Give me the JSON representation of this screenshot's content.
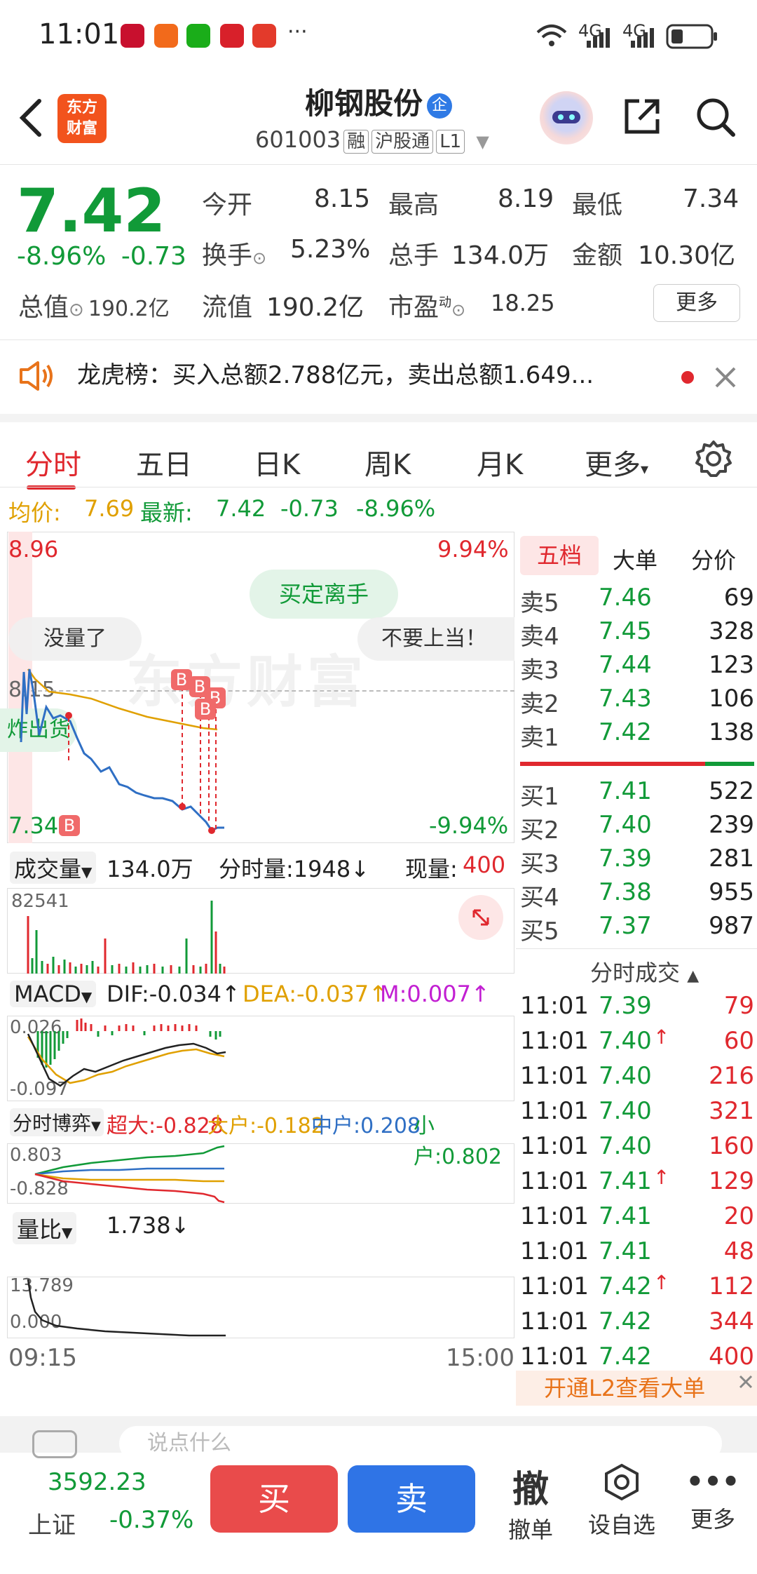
{
  "status": {
    "time": "11:01",
    "more_dots": "···",
    "net1": "4G",
    "net2": "4G"
  },
  "header": {
    "logo_line1": "东方",
    "logo_line2": "财富",
    "stock_name": "柳钢股份",
    "ent_badge": "企",
    "stock_code": "601003",
    "tag_rong": "融",
    "tag_hgt": "沪股通",
    "tag_level": "L1"
  },
  "quote": {
    "price": "7.42",
    "change_pct": "-8.96%",
    "change_abs": "-0.73",
    "open_label": "今开",
    "open": "8.15",
    "high_label": "最高",
    "high": "8.19",
    "low_label": "最低",
    "low": "7.34",
    "turnover_label": "换手",
    "turnover": "5.23%",
    "volume_label": "总手",
    "volume": "134.0万",
    "amount_label": "金额",
    "amount": "10.30亿",
    "mktcap_label": "总值",
    "mktcap": "190.2亿",
    "float_label": "流值",
    "float_cap": "190.2亿",
    "pe_label": "市盈",
    "pe_sup": "动",
    "pe": "18.25",
    "more_label": "更多"
  },
  "news": {
    "text": "龙虎榜：买入总额2.788亿元，卖出总额1.649..."
  },
  "tabs": [
    "分时",
    "五日",
    "日K",
    "周K",
    "月K",
    "更多"
  ],
  "avg_line": {
    "avg_label": "均价:",
    "avg": "7.69",
    "latest_label": "最新:",
    "latest": "7.42",
    "change": "-0.73",
    "change_pct": "-8.96%"
  },
  "chart": {
    "price_high": "8.96",
    "pct_high": "9.94%",
    "price_low": "7.34",
    "pct_low": "-9.94%",
    "ref_price": "8.15",
    "bullet_1": "买定离手",
    "bullet_2": "没量了",
    "bullet_3": "不要上当！",
    "bullet_4": "炸出货",
    "watermark": "东方财富",
    "vol_selector": "成交量",
    "vol_total": "134.0万",
    "vol_tick_label": "分时量:1948↓",
    "vol_now_label": "现量:",
    "vol_now": "400",
    "vol_max": "82541",
    "macd_selector": "MACD",
    "macd_dif": "DIF:-0.034↑",
    "macd_dea": "DEA:-0.037↑",
    "macd_m": "M:0.007↑",
    "macd_top": "0.026",
    "macd_bottom": "-0.097",
    "flow_selector": "分时博弈",
    "flow_super": "超大:-0.828",
    "flow_big": "大户:-0.182",
    "flow_mid": "中户:0.208",
    "flow_small": "小户:0.802",
    "flow_top": "0.803",
    "flow_bottom": "-0.828",
    "ratio_selector": "量比",
    "ratio_value": "1.738↓",
    "ratio_top": "13.789",
    "ratio_bottom": "0.000",
    "time_start": "09:15",
    "time_end": "15:00",
    "marker": "B"
  },
  "book": {
    "tab_five": "五档",
    "tab_big": "大单",
    "tab_price": "分价",
    "asks": [
      {
        "label": "卖5",
        "price": "7.46",
        "vol": "69"
      },
      {
        "label": "卖4",
        "price": "7.45",
        "vol": "328"
      },
      {
        "label": "卖3",
        "price": "7.44",
        "vol": "123"
      },
      {
        "label": "卖2",
        "price": "7.43",
        "vol": "106"
      },
      {
        "label": "卖1",
        "price": "7.42",
        "vol": "138"
      }
    ],
    "bids": [
      {
        "label": "买1",
        "price": "7.41",
        "vol": "522"
      },
      {
        "label": "买2",
        "price": "7.40",
        "vol": "239"
      },
      {
        "label": "买3",
        "price": "7.39",
        "vol": "281"
      },
      {
        "label": "买4",
        "price": "7.38",
        "vol": "955"
      },
      {
        "label": "买5",
        "price": "7.37",
        "vol": "987"
      }
    ],
    "ticks_title": "分时成交",
    "ticks": [
      {
        "time": "11:01",
        "price": "7.39",
        "vol": "79",
        "arrow": ""
      },
      {
        "time": "11:01",
        "price": "7.40",
        "vol": "60",
        "arrow": "↑"
      },
      {
        "time": "11:01",
        "price": "7.40",
        "vol": "216",
        "arrow": ""
      },
      {
        "time": "11:01",
        "price": "7.40",
        "vol": "321",
        "arrow": ""
      },
      {
        "time": "11:01",
        "price": "7.40",
        "vol": "160",
        "arrow": ""
      },
      {
        "time": "11:01",
        "price": "7.41",
        "vol": "129",
        "arrow": "↑"
      },
      {
        "time": "11:01",
        "price": "7.41",
        "vol": "20",
        "arrow": ""
      },
      {
        "time": "11:01",
        "price": "7.41",
        "vol": "48",
        "arrow": ""
      },
      {
        "time": "11:01",
        "price": "7.42",
        "vol": "112",
        "arrow": "↑"
      },
      {
        "time": "11:01",
        "price": "7.42",
        "vol": "344",
        "arrow": ""
      },
      {
        "time": "11:01",
        "price": "7.42",
        "vol": "400",
        "arrow": ""
      }
    ],
    "l2_promo": "开通L2查看大单"
  },
  "bottom": {
    "index_value": "3592.23",
    "index_name": "上证",
    "index_change": "-0.37%",
    "buy": "买",
    "sell": "卖",
    "cancel_glyph": "撤",
    "cancel_label": "撤单",
    "watch_label": "设自选",
    "more_label": "更多",
    "comment_hint": "说点什么"
  },
  "colors": {
    "up": "#e0282e",
    "down": "#119a38",
    "avg": "#e0a000",
    "price_line": "#2f6fc4"
  }
}
